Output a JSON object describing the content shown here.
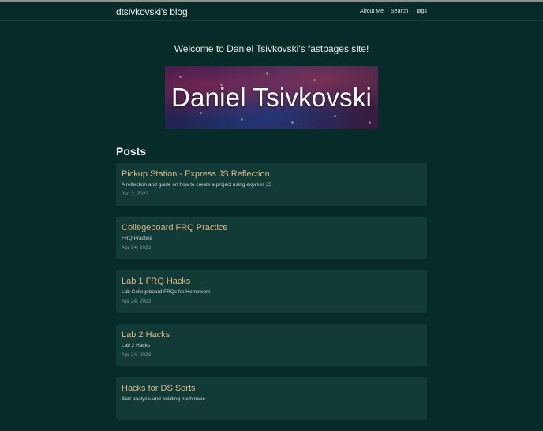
{
  "header": {
    "site_title": "dtsivkovski's blog",
    "nav": [
      {
        "label": "About Me"
      },
      {
        "label": "Search"
      },
      {
        "label": "Tags"
      }
    ]
  },
  "main": {
    "welcome": "Welcome to Daniel Tsivkovski's fastpages site!",
    "banner_text": "Daniel Tsivkovski",
    "posts_heading": "Posts",
    "posts": [
      {
        "title": "Pickup Station - Express JS Reflection",
        "description": "A relfection and guide on how to create a project using express JS",
        "date": "Jun 2, 2023"
      },
      {
        "title": "Collegeboard FRQ Practice",
        "description": "FRQ Practice",
        "date": "Apr 24, 2023"
      },
      {
        "title": "Lab 1 FRQ Hacks",
        "description": "Lab Collegeboard FRQs for Homework",
        "date": "Apr 24, 2023"
      },
      {
        "title": "Lab 2 Hacks",
        "description": "Lab 2 Hacks",
        "date": "Apr 24, 2023"
      },
      {
        "title": "Hacks for DS Sorts",
        "description": "Sort analysis and building hashmaps",
        "date": ""
      }
    ]
  },
  "colors": {
    "background": "#062b28",
    "card": "#123a36",
    "post_title": "#d9b88a"
  }
}
